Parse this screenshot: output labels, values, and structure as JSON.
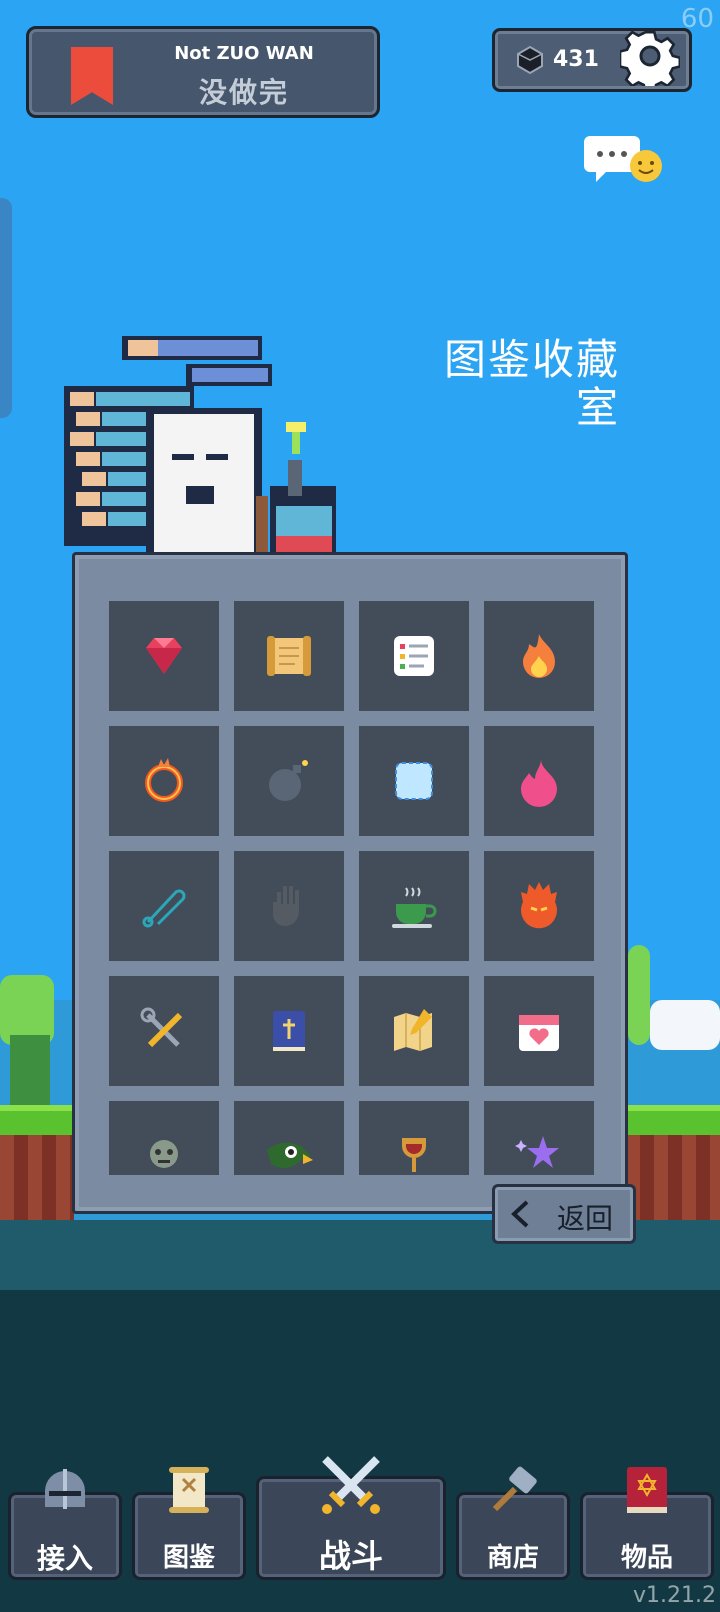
{
  "fps": "60",
  "version": "v1.21.2",
  "header": {
    "title_en": "Not ZUO WAN",
    "title_cn": "没做完"
  },
  "currency": {
    "gems": "431"
  },
  "hall_title": "图鉴收藏室",
  "grid": {
    "items": [
      {
        "icon": "ruby-gem-icon",
        "color": "#e8415f"
      },
      {
        "icon": "scroll-icon",
        "color": "#f2c77a"
      },
      {
        "icon": "checklist-icon",
        "color": "#ffffff"
      },
      {
        "icon": "fire-icon",
        "color": "#f5803e"
      },
      {
        "icon": "fire-ring-icon",
        "color": "#f25a1f"
      },
      {
        "icon": "bomb-icon",
        "color": "#5a6675"
      },
      {
        "icon": "ice-square-icon",
        "color": "#bfe7ff"
      },
      {
        "icon": "pink-flame-icon",
        "color": "#ef4f8a"
      },
      {
        "icon": "safety-pin-icon",
        "color": "#2aa7b8"
      },
      {
        "icon": "dark-hand-icon",
        "color": "#555"
      },
      {
        "icon": "tea-cup-icon",
        "color": "#3c9a4c"
      },
      {
        "icon": "fire-spirit-icon",
        "color": "#ef5a2a"
      },
      {
        "icon": "tools-icon",
        "color": "#f0b52b"
      },
      {
        "icon": "holy-book-icon",
        "color": "#3b4fa8"
      },
      {
        "icon": "treasure-map-icon",
        "color": "#f2d38a"
      },
      {
        "icon": "calendar-heart-icon",
        "color": "#f26d8a"
      },
      {
        "icon": "zombie-icon",
        "color": "#8a9a8a"
      },
      {
        "icon": "eagle-icon",
        "color": "#2e6a2e"
      },
      {
        "icon": "goblet-icon",
        "color": "#d79a3a"
      },
      {
        "icon": "magic-star-icon",
        "color": "#9b6ef0"
      }
    ]
  },
  "back_button": {
    "label": "返回"
  },
  "nav": {
    "items": [
      {
        "id": "join",
        "label": "接入",
        "icon": "knight-helmet-icon"
      },
      {
        "id": "codex",
        "label": "图鉴",
        "icon": "scroll-skull-icon"
      },
      {
        "id": "battle",
        "label": "战斗",
        "icon": "crossed-swords-icon"
      },
      {
        "id": "shop",
        "label": "商店",
        "icon": "hammer-icon"
      },
      {
        "id": "items",
        "label": "物品",
        "icon": "spell-book-icon"
      }
    ]
  }
}
